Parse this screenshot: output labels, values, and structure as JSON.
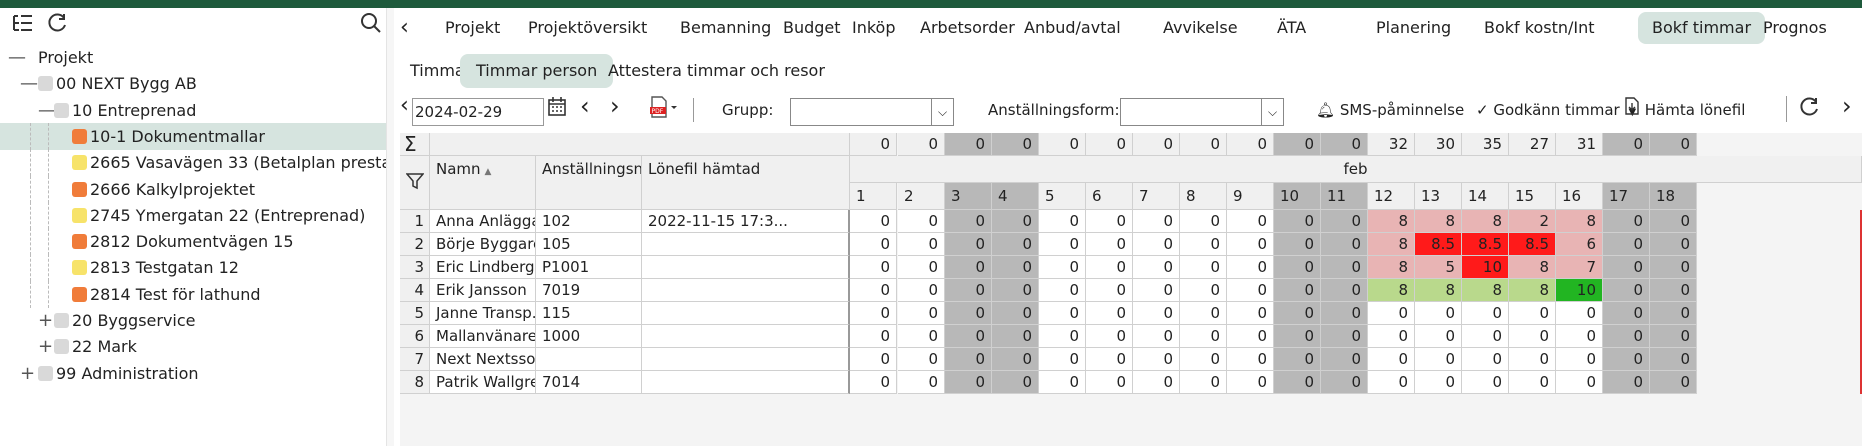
{
  "toolbar_left": {
    "tree_icon": "tree-list-icon",
    "refresh_icon": "refresh-icon",
    "search_icon": "search-icon"
  },
  "tree": [
    {
      "label": "Projekt",
      "level": 0,
      "toggle": "—",
      "color": ""
    },
    {
      "label": "00 NEXT Bygg AB",
      "level": 1,
      "toggle": "—",
      "color": "#d9d9d9"
    },
    {
      "label": "10 Entreprenad",
      "level": 2,
      "toggle": "—",
      "color": "#d9d9d9"
    },
    {
      "label": "10-1 Dokumentmallar",
      "level": 3,
      "toggle": "",
      "color": "#f07c3a",
      "selected": true
    },
    {
      "label": "2665 Vasavägen 33 (Betalplan presta",
      "level": 3,
      "toggle": "",
      "color": "#f7e36a"
    },
    {
      "label": "2666 Kalkylprojektet",
      "level": 3,
      "toggle": "",
      "color": "#f07c3a"
    },
    {
      "label": "2745 Ymergatan 22 (Entreprenad)",
      "level": 3,
      "toggle": "",
      "color": "#f7e36a"
    },
    {
      "label": "2812 Dokumentvägen 15",
      "level": 3,
      "toggle": "",
      "color": "#f07c3a"
    },
    {
      "label": "2813 Testgatan 12",
      "level": 3,
      "toggle": "",
      "color": "#f7e36a"
    },
    {
      "label": "2814 Test för lathund",
      "level": 3,
      "toggle": "",
      "color": "#f07c3a"
    },
    {
      "label": "20 Byggservice",
      "level": 2,
      "toggle": "+",
      "color": "#d9d9d9"
    },
    {
      "label": "22 Mark",
      "level": 2,
      "toggle": "+",
      "color": "#d9d9d9"
    },
    {
      "label": "99 Administration",
      "level": 1,
      "toggle": "+",
      "color": "#d9d9d9"
    }
  ],
  "tabs": [
    "Projekt",
    "Projektöversikt",
    "Bemanning",
    "Budget",
    "Inköp",
    "Arbetsorder",
    "Anbud/avtal",
    "Avvikelse",
    "ÄTA",
    "Planering",
    "Bokf kostn/Int",
    "Bokf timmar",
    "Prognos"
  ],
  "active_tab": "Bokf timmar",
  "subtabs": [
    "Timmar projekt",
    "Timmar person",
    "Attestera timmar och resor"
  ],
  "active_subtab": "Timmar person",
  "toolbar": {
    "date": "2024-02-29",
    "group_label": "Grupp:",
    "group_value": "",
    "employment_label": "Anställningsform:",
    "employment_value": "",
    "sms": "SMS-påminnelse",
    "approve": "Godkänn timmar",
    "fetch": "Hämta lönefil"
  },
  "grid": {
    "col_name": "Namn",
    "col_emp": "Anställningsnr",
    "col_file": "Lönefil hämtad",
    "month": "feb",
    "days": [
      "1",
      "2",
      "3",
      "4",
      "5",
      "6",
      "7",
      "8",
      "9",
      "10",
      "11",
      "12",
      "13",
      "14",
      "15",
      "16",
      "17",
      "18"
    ],
    "weekend": [
      3,
      4,
      10,
      11,
      17,
      18
    ],
    "totals": [
      "0",
      "0",
      "0",
      "0",
      "0",
      "0",
      "0",
      "0",
      "0",
      "0",
      "0",
      "32",
      "30",
      "35",
      "27",
      "31",
      "0",
      "0"
    ],
    "rows": [
      {
        "n": "1",
        "name": "Anna Anlägga...",
        "emp": "102",
        "file": "2022-11-15 17:3...",
        "vals": [
          "0",
          "0",
          "0",
          "0",
          "0",
          "0",
          "0",
          "0",
          "0",
          "0",
          "0",
          "8",
          "8",
          "8",
          "2",
          "8",
          "0",
          "0"
        ]
      },
      {
        "n": "2",
        "name": "Börje Byggare...",
        "emp": "105",
        "file": "",
        "vals": [
          "0",
          "0",
          "0",
          "0",
          "0",
          "0",
          "0",
          "0",
          "0",
          "0",
          "0",
          "8",
          "8.5",
          "8.5",
          "8.5",
          "6",
          "0",
          "0"
        ]
      },
      {
        "n": "3",
        "name": "Eric Lindberg",
        "emp": "P1001",
        "file": "",
        "vals": [
          "0",
          "0",
          "0",
          "0",
          "0",
          "0",
          "0",
          "0",
          "0",
          "0",
          "0",
          "8",
          "5",
          "10",
          "8",
          "7",
          "0",
          "0"
        ]
      },
      {
        "n": "4",
        "name": "Erik Jansson",
        "emp": "7019",
        "file": "",
        "vals": [
          "0",
          "0",
          "0",
          "0",
          "0",
          "0",
          "0",
          "0",
          "0",
          "0",
          "0",
          "8",
          "8",
          "8",
          "8",
          "10",
          "0",
          "0"
        ]
      },
      {
        "n": "5",
        "name": "Janne Transp...",
        "emp": "115",
        "file": "",
        "vals": [
          "0",
          "0",
          "0",
          "0",
          "0",
          "0",
          "0",
          "0",
          "0",
          "0",
          "0",
          "0",
          "0",
          "0",
          "0",
          "0",
          "0",
          "0"
        ]
      },
      {
        "n": "6",
        "name": "Mallanvänare ...",
        "emp": "1000",
        "file": "",
        "vals": [
          "0",
          "0",
          "0",
          "0",
          "0",
          "0",
          "0",
          "0",
          "0",
          "0",
          "0",
          "0",
          "0",
          "0",
          "0",
          "0",
          "0",
          "0"
        ]
      },
      {
        "n": "7",
        "name": "Next Nextsson",
        "emp": "",
        "file": "",
        "vals": [
          "0",
          "0",
          "0",
          "0",
          "0",
          "0",
          "0",
          "0",
          "0",
          "0",
          "0",
          "0",
          "0",
          "0",
          "0",
          "0",
          "0",
          "0"
        ]
      },
      {
        "n": "8",
        "name": "Patrik Wallgren",
        "emp": "7014",
        "file": "",
        "vals": [
          "0",
          "0",
          "0",
          "0",
          "0",
          "0",
          "0",
          "0",
          "0",
          "0",
          "0",
          "0",
          "0",
          "0",
          "0",
          "0",
          "0",
          "0"
        ]
      }
    ],
    "cell_colors": {
      "under": "#e8b4b4",
      "over": "#ff1a1a",
      "ok": "#b9d98c",
      "high": "#22b522"
    }
  }
}
